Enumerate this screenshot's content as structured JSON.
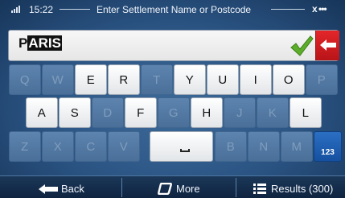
{
  "status": {
    "time": "15:22",
    "title": "Enter Settlement Name or Postcode",
    "signal_icon": "signal-icon",
    "gps_indicator": "x •••"
  },
  "search": {
    "typed_prefix": "P",
    "autocomplete_suffix": "ARIS",
    "confirm_icon": "checkmark-icon",
    "backspace_icon": "backspace-arrow-icon",
    "accent_colors": {
      "confirm": "#5cae2a",
      "backspace": "#d81e22"
    }
  },
  "keyboard": {
    "row1": [
      {
        "label": "Q",
        "enabled": false
      },
      {
        "label": "W",
        "enabled": false
      },
      {
        "label": "E",
        "enabled": true
      },
      {
        "label": "R",
        "enabled": true
      },
      {
        "label": "T",
        "enabled": false
      },
      {
        "label": "Y",
        "enabled": true
      },
      {
        "label": "U",
        "enabled": true
      },
      {
        "label": "I",
        "enabled": true
      },
      {
        "label": "O",
        "enabled": true
      },
      {
        "label": "P",
        "enabled": false
      }
    ],
    "row2": [
      {
        "label": "A",
        "enabled": true
      },
      {
        "label": "S",
        "enabled": true
      },
      {
        "label": "D",
        "enabled": false
      },
      {
        "label": "F",
        "enabled": true
      },
      {
        "label": "G",
        "enabled": false
      },
      {
        "label": "H",
        "enabled": true
      },
      {
        "label": "J",
        "enabled": false
      },
      {
        "label": "K",
        "enabled": false
      },
      {
        "label": "L",
        "enabled": true
      }
    ],
    "row3_left": [
      {
        "label": "Z",
        "enabled": false
      },
      {
        "label": "X",
        "enabled": false
      },
      {
        "label": "C",
        "enabled": false
      },
      {
        "label": "V",
        "enabled": false
      }
    ],
    "space_label": "space",
    "row3_right": [
      {
        "label": "B",
        "enabled": false
      },
      {
        "label": "N",
        "enabled": false
      },
      {
        "label": "M",
        "enabled": false
      }
    ],
    "numeric_label": "123"
  },
  "bottom_bar": {
    "back_label": "Back",
    "back_icon": "arrow-left-icon",
    "more_label": "More",
    "more_icon": "rounded-square-icon",
    "results_label": "Results (300)",
    "results_icon": "list-icon"
  }
}
